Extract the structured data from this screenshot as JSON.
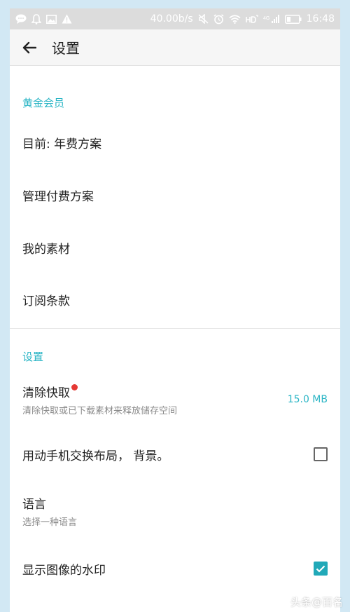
{
  "status_bar": {
    "speed": "40.00b/s",
    "network": "4G",
    "time": "16:48"
  },
  "app_bar": {
    "title": "设置"
  },
  "gold": {
    "header": "黄金会员",
    "items": [
      {
        "label": "目前: 年费方案"
      },
      {
        "label": "管理付费方案"
      },
      {
        "label": "我的素材"
      },
      {
        "label": "订阅条款"
      }
    ]
  },
  "settings": {
    "header": "设置",
    "clear_cache": {
      "label": "清除快取",
      "sublabel": "清除快取或已下载素材来释放储存空间",
      "value": "15.0 MB"
    },
    "swap_layout": {
      "label": "用动手机交换布局， 背景。",
      "checked": false
    },
    "language": {
      "label": "语言",
      "sublabel": "选择一种语言"
    },
    "watermark": {
      "label": "显示图像的水印",
      "checked": true
    }
  },
  "overlay": {
    "watermark_text": "头条@百名"
  },
  "colors": {
    "accent": "#2ab5c5",
    "status_bar": "#dcdcdc",
    "badge": "#e53935"
  }
}
